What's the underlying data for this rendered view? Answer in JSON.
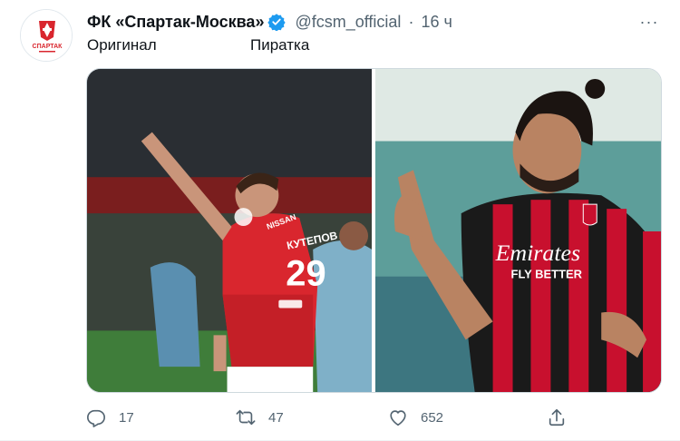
{
  "tweet": {
    "author_name": "ФК «Спартак-Москва»",
    "handle": "@fcsm_official",
    "separator": "·",
    "time": "16 ч",
    "more_label": "···",
    "avatar_text": "СПАРТАК",
    "caption_left": "Оригинал",
    "caption_right": "Пиратка"
  },
  "media": {
    "left_photo": {
      "jersey_text": "КУТЕПОВ",
      "number": "29",
      "sponsor": "NISSAN"
    },
    "right_photo": {
      "sponsor": "Emirates",
      "sponsor_line2": "FLY BETTER"
    }
  },
  "actions": {
    "reply": {
      "icon": "reply-icon",
      "count": "17"
    },
    "retweet": {
      "icon": "retweet-icon",
      "count": "47"
    },
    "like": {
      "icon": "heart-icon",
      "count": "652"
    },
    "share": {
      "icon": "share-icon"
    }
  },
  "colors": {
    "brand_red": "#d9262e",
    "verified_blue": "#1d9bf0",
    "muted": "#536471"
  }
}
